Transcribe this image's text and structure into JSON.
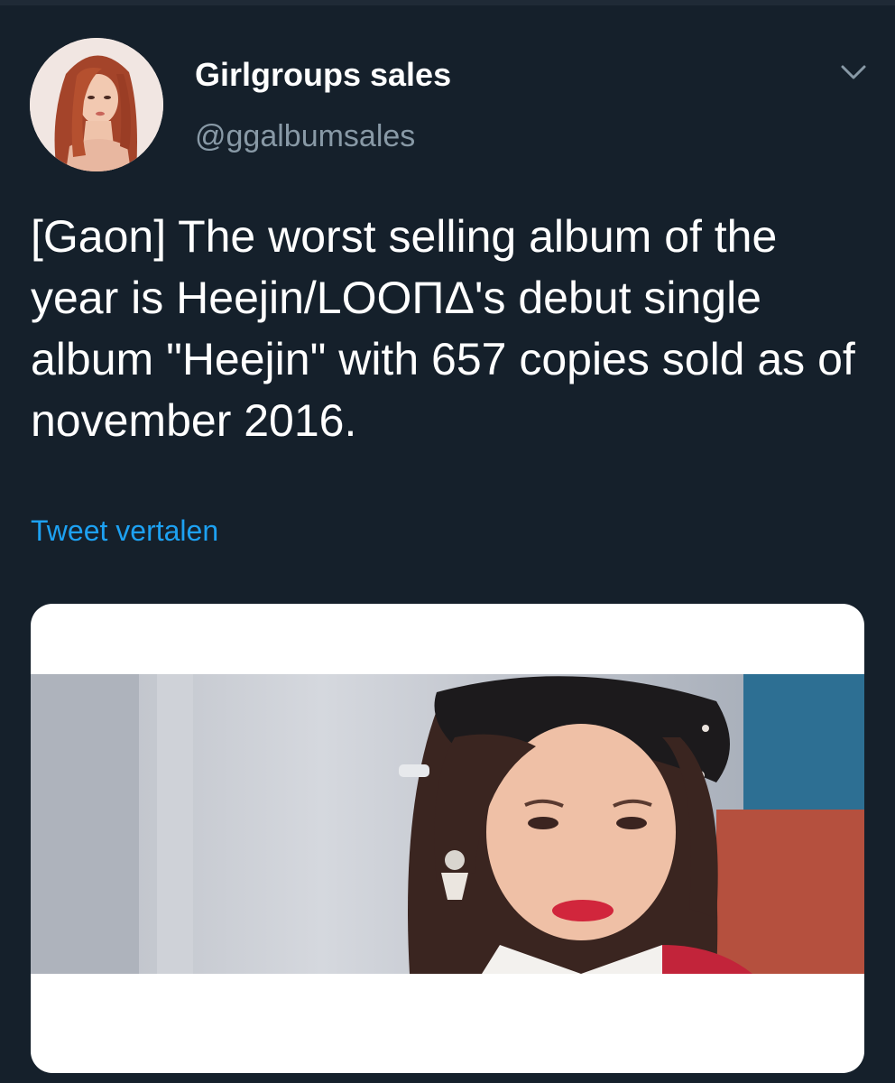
{
  "tweet": {
    "author": {
      "display_name": "Girlgroups sales",
      "handle": "@ggalbumsales",
      "avatar_icon": "profile-photo"
    },
    "menu_icon": "chevron-down-icon",
    "text": "[Gaon] The worst selling album of the year is Heejin/LOOΠΔ's debut single album \"Heejin\" with 657 copies sold as of november 2016.",
    "translate_label": "Tweet vertalen",
    "media": {
      "kind": "video-still"
    }
  },
  "colors": {
    "background": "#15202b",
    "text_primary": "#ffffff",
    "text_secondary": "#8899a6",
    "link": "#1da1f2"
  }
}
